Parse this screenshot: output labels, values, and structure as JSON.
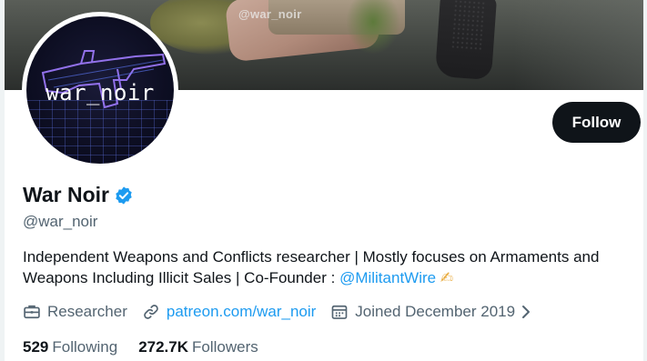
{
  "banner": {
    "watermark": "@war_noir"
  },
  "avatar": {
    "text": "war_noir"
  },
  "profile": {
    "display_name": "War Noir",
    "handle": "@war_noir",
    "verified": true,
    "bio_text": "Independent Weapons and Conflicts researcher | Mostly focuses on Armaments and Weapons Including Illicit Sales | Co-Founder : ",
    "bio_mention": "@MilitantWire",
    "bio_emoji": "✍",
    "follow_label": "Follow"
  },
  "meta": {
    "profession": "Researcher",
    "profession_icon": "briefcase-icon",
    "website": "patreon.com/war_noir",
    "website_icon": "link-icon",
    "joined": "Joined December 2019",
    "joined_icon": "calendar-icon"
  },
  "stats": {
    "following_count": "529",
    "following_label": "Following",
    "followers_count": "272.7K",
    "followers_label": "Followers"
  },
  "colors": {
    "accent": "#1d9bf0",
    "text": "#0f1419",
    "muted": "#536471"
  }
}
